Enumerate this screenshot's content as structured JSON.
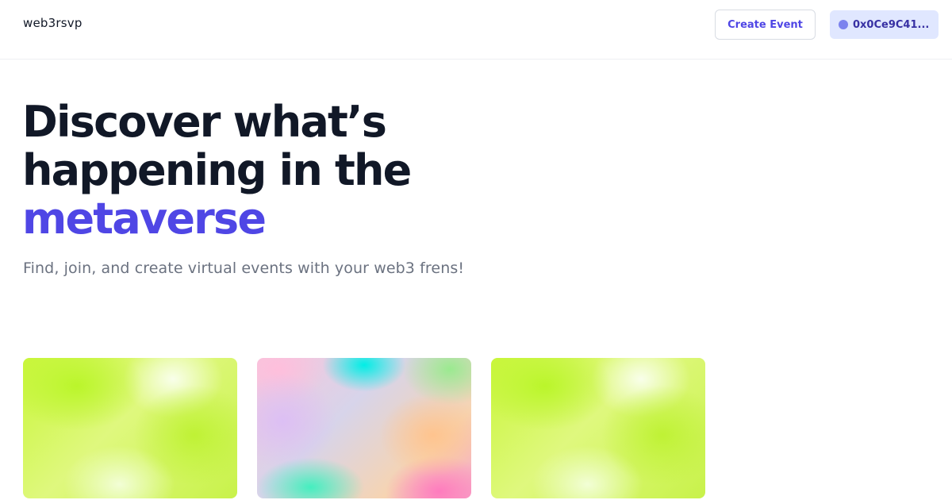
{
  "navbar": {
    "brand": "web3rsvp",
    "create_event_label": "Create Event",
    "wallet_label": "0x0Ce9C41..."
  },
  "hero": {
    "title_line_1": "Discover what’s",
    "title_line_2": "happening in the",
    "title_accent": "metaverse",
    "subtitle": "Find, join, and create virtual events with your web3 frens!"
  },
  "colors": {
    "accent": "#4f46e5",
    "wallet_bg": "#e0e7ff",
    "text_dark": "#111827",
    "text_muted": "#6b7280"
  },
  "events": [
    {
      "image": "gradient-lime"
    },
    {
      "image": "gradient-pastel"
    },
    {
      "image": "gradient-lime"
    }
  ]
}
